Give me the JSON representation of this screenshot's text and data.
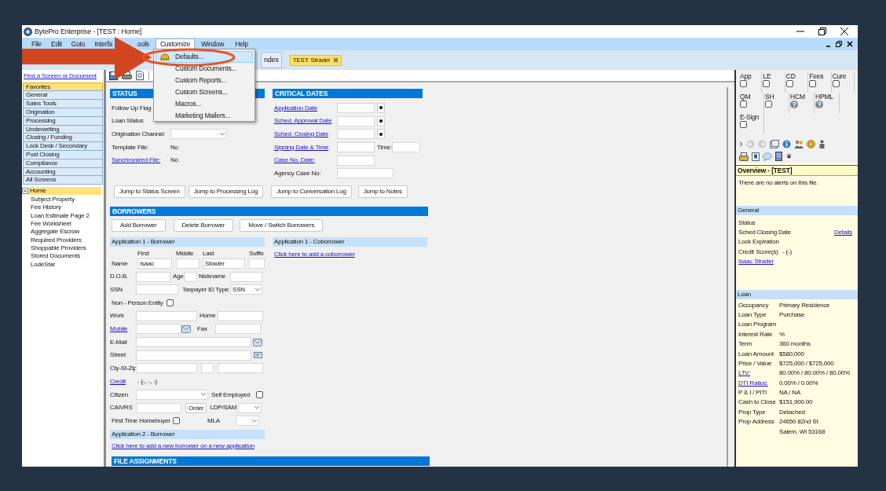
{
  "window": {
    "title": "BytePro Enterprise - [TEST : Home]"
  },
  "menu_bar": [
    {
      "label": "File",
      "open": false
    },
    {
      "label": "Edit",
      "open": false
    },
    {
      "label": "Goto",
      "open": false
    },
    {
      "label": "Interfa",
      "open": false
    },
    {
      "label": "ools",
      "open": false
    },
    {
      "label": "Customize",
      "open": true
    },
    {
      "label": "Window",
      "open": false
    },
    {
      "label": "Help",
      "open": false
    }
  ],
  "toolbar": {
    "partial_button": "ndes",
    "file_tab": "TEST: Strader"
  },
  "customize_menu": [
    {
      "label": "Defaults...",
      "selected": true
    },
    {
      "label": "Custom Documents...",
      "selected": false
    },
    {
      "label": "Custom Reports...",
      "selected": false
    },
    {
      "label": "Custom Screens...",
      "selected": false
    },
    {
      "label": "Macros...",
      "selected": false
    },
    {
      "label": "Marketing Mailers...",
      "selected": false
    }
  ],
  "sidebar": {
    "find_link": "Find a Screen or Document",
    "categories": [
      {
        "label": "Favorites",
        "selected": true
      },
      {
        "label": "General",
        "selected": false
      },
      {
        "label": "Sales Tools",
        "selected": false
      },
      {
        "label": "Origination",
        "selected": false
      },
      {
        "label": "Processing",
        "selected": false
      },
      {
        "label": "Underwriting",
        "selected": false
      },
      {
        "label": "Closing / Funding",
        "selected": false
      },
      {
        "label": "Lock Desk / Secondary",
        "selected": false
      },
      {
        "label": "Post Closing",
        "selected": false
      },
      {
        "label": "Compliance",
        "selected": false
      },
      {
        "label": "Accounting",
        "selected": false
      },
      {
        "label": "All Screens",
        "selected": false
      }
    ],
    "tree": [
      {
        "label": "Home",
        "selected": true,
        "expanded": true,
        "children": [
          {
            "label": "Subject Property",
            "selected": false
          },
          {
            "label": "Fee History",
            "selected": false
          },
          {
            "label": "Loan Estimate Page 2",
            "selected": false
          },
          {
            "label": "Fee Worksheet",
            "selected": false
          },
          {
            "label": "Aggregate Escrow",
            "selected": false
          },
          {
            "label": "Required Providers",
            "selected": false
          },
          {
            "label": "Shoppable Providers",
            "selected": false
          },
          {
            "label": "Stored Documents",
            "selected": false
          },
          {
            "label": "LodeStar",
            "selected": false
          }
        ]
      }
    ]
  },
  "status": {
    "title": "STATUS",
    "rows": [
      {
        "label": "Follow Up Flag",
        "kind": "plain"
      },
      {
        "label": "Loan Status",
        "kind": "plain"
      },
      {
        "label": "Origination Channel",
        "kind": "select"
      },
      {
        "label": "Template File:",
        "kind": "text",
        "value": "No"
      },
      {
        "label": "Synchronized File:",
        "kind": "link",
        "value": "No"
      }
    ]
  },
  "critical_dates": {
    "title": "CRITICAL DATES",
    "rows": [
      {
        "label": "Application Date",
        "kind": "date"
      },
      {
        "label": "Sched. Approval Date",
        "kind": "date"
      },
      {
        "label": "Sched. Closing Date",
        "kind": "date"
      },
      {
        "label": "Signing Date & Time",
        "kind": "datetime",
        "time_label": "Time:"
      },
      {
        "label": "Case No. Date:",
        "kind": "plain_date"
      },
      {
        "label": "Agency Case No:",
        "kind": "text"
      }
    ]
  },
  "jump_buttons": [
    "Jump to Status Screen",
    "Jump to Processing Log",
    "Jump to Conversation Log",
    "Jump to Notes"
  ],
  "borrowers": {
    "title": "BORROWERS",
    "buttons": [
      "Add Borrower",
      "Delete Borrower",
      "Move / Switch Borrowers"
    ],
    "coborrower_header": "Application 1 - Coborrower",
    "coborrower_link": "Click here to add a coborrower",
    "app2_header": "Application 2 - Borrower",
    "app2_link": "Click here to add a new borrower on a new application"
  },
  "borrower": {
    "header": "Application 1 - Borrower",
    "name_label": "Name",
    "name_parts": [
      {
        "head": "First",
        "value": "Isaac"
      },
      {
        "head": "Middle"
      },
      {
        "head": "Last",
        "value": "Strader"
      },
      {
        "head": "Suffix"
      }
    ],
    "dob_label": "D.O.B.",
    "age_label": "Age",
    "nickname_label": "Nickname",
    "ssn_label": "SSN",
    "taxpayer_label": "Taxpayer ID Type",
    "taxpayer_value": "SSN",
    "non_person_label": "Non - Person Entity",
    "non_person_checked": false,
    "work_label": "Work",
    "home_label": "Home",
    "mobile_label": "Mobile",
    "fax_label": "Fax",
    "email_label": "E-Mail",
    "street_label": "Street",
    "city_label": "Cty-St-Zip",
    "credit_label": "Credit",
    "credit_value": "- (-, -, -)",
    "citizen_label": "Citizen",
    "self_employed_label": "Self Employed",
    "self_employed_checked": false,
    "caivrs_label": "CAIVRS",
    "order_button": "Order",
    "ldp_label": "LDP/SAM",
    "first_time_label": "First Time Homebuyer",
    "first_time_checked": false,
    "mla_label": "MLA"
  },
  "file_assignments": {
    "title": "FILE ASSIGNMENTS"
  },
  "right_panel": {
    "flag_rows": [
      [
        {
          "label": "App",
          "kind": "checkbox",
          "checked": false
        },
        {
          "label": "LE",
          "kind": "checkbox",
          "checked": false
        },
        {
          "label": "CD",
          "kind": "checkbox",
          "checked": false
        },
        {
          "label": "Fees",
          "kind": "checkbox",
          "checked": false
        },
        {
          "label": "Cure",
          "kind": "checkbox",
          "checked": false
        }
      ],
      [
        {
          "label": "QM",
          "kind": "checkbox",
          "checked": false
        },
        {
          "label": "SH",
          "kind": "checkbox",
          "checked": false
        },
        {
          "label": "HCM",
          "kind": "help"
        },
        {
          "label": "HPML",
          "kind": "help"
        }
      ],
      [
        {
          "label": "E-Sign",
          "kind": "checkbox",
          "checked": false
        }
      ]
    ],
    "overview_title": "Overview - [TEST]",
    "alert": "There are no alerts on this file.",
    "general": {
      "header": "General",
      "rows": [
        {
          "label": "Status"
        },
        {
          "label": "Sched Closing Date",
          "link": "Details"
        },
        {
          "label": "Lock Expiration"
        },
        {
          "label": "Credit Score(s)",
          "value": "- (-)"
        }
      ],
      "person_link": "Isaac Strader"
    },
    "loan": {
      "header": "Loan",
      "rows": [
        {
          "label": "Occupancy",
          "value": "Primary Residence"
        },
        {
          "label": "Loan Type",
          "value": "Purchase"
        },
        {
          "label": "Loan Program"
        },
        {
          "label": "Interest Rate",
          "value": "%"
        },
        {
          "label": "Term",
          "value": "360 months"
        },
        {
          "label": "Loan Amount",
          "value": "$580,000"
        },
        {
          "label": "Price / Value",
          "value": "$725,000 / $725,000"
        },
        {
          "label": "LTV:",
          "value": "80.00% / 80.00% / 80.00%",
          "link": true
        },
        {
          "label": "DTI Ratios:",
          "value": "0.00% / 0.00%",
          "link": true
        },
        {
          "label": "P & I / PITI",
          "value": "NA / NA"
        },
        {
          "label": "Cash to Close",
          "value": "$151,900.00"
        },
        {
          "label": "Prop Type",
          "value": "Detached"
        },
        {
          "label": "Prop Address",
          "value": "24650 82nd St",
          "value_line2": "Salem, WI 53168"
        }
      ]
    }
  }
}
